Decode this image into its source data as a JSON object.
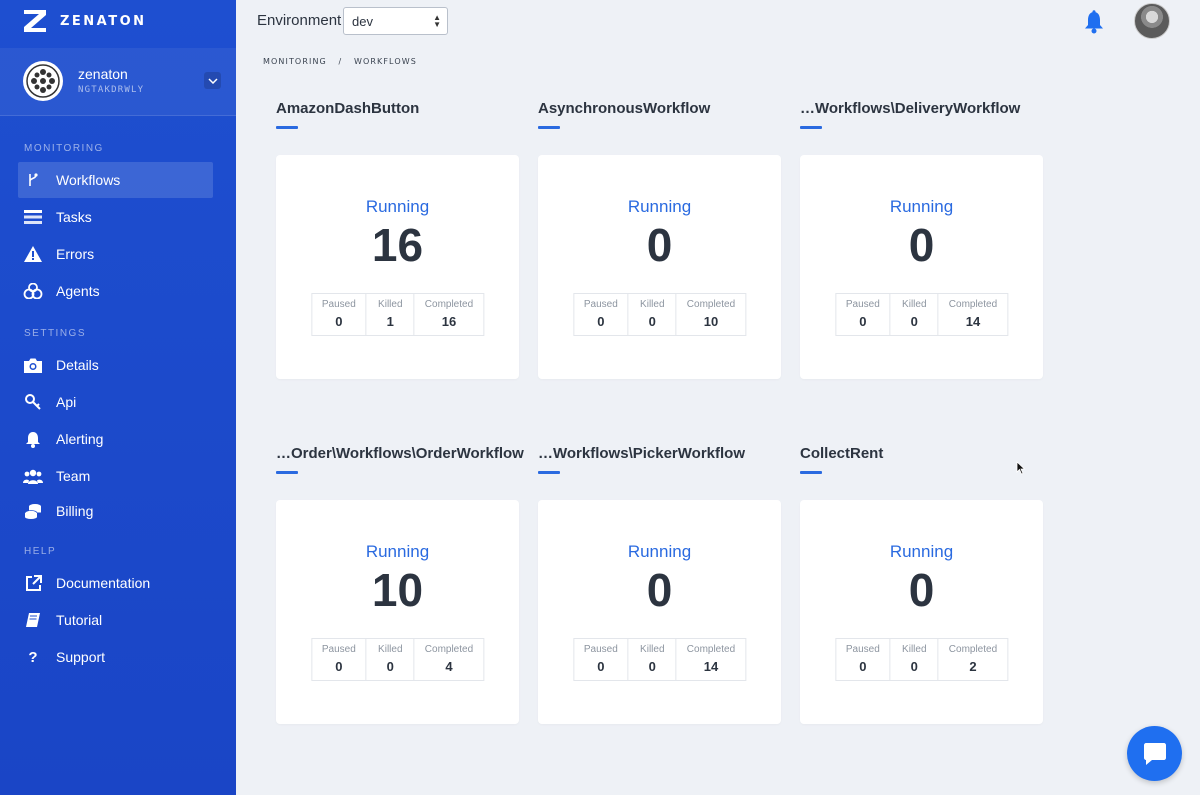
{
  "brand": {
    "name": "ZENATON"
  },
  "account": {
    "name": "zenaton",
    "id": "NGTAKDRWLY"
  },
  "sidebar": {
    "sections": [
      {
        "title": "MONITORING",
        "items": [
          {
            "label": "Workflows",
            "icon": "branch-icon",
            "active": true
          },
          {
            "label": "Tasks",
            "icon": "list-icon"
          },
          {
            "label": "Errors",
            "icon": "warning-icon"
          },
          {
            "label": "Agents",
            "icon": "agents-icon"
          }
        ]
      },
      {
        "title": "SETTINGS",
        "items": [
          {
            "label": "Details",
            "icon": "camera-icon"
          },
          {
            "label": "Api",
            "icon": "key-icon"
          },
          {
            "label": "Alerting",
            "icon": "bell-icon"
          },
          {
            "label": "Team",
            "icon": "team-icon"
          },
          {
            "label": "Billing",
            "icon": "coins-icon"
          }
        ]
      },
      {
        "title": "HELP",
        "items": [
          {
            "label": "Documentation",
            "icon": "external-link-icon"
          },
          {
            "label": "Tutorial",
            "icon": "book-icon"
          },
          {
            "label": "Support",
            "icon": "question-icon"
          }
        ]
      }
    ]
  },
  "topbar": {
    "env_label": "Environment",
    "env_value": "dev"
  },
  "breadcrumb": [
    "MONITORING",
    "/",
    "WORKFLOWS"
  ],
  "labels": {
    "running": "Running",
    "paused": "Paused",
    "killed": "Killed",
    "completed": "Completed"
  },
  "workflows": [
    {
      "name": "AmazonDashButton",
      "running": "16",
      "paused": "0",
      "killed": "1",
      "completed": "16"
    },
    {
      "name": "AsynchronousWorkflow",
      "running": "0",
      "paused": "0",
      "killed": "0",
      "completed": "10"
    },
    {
      "name": "…Workflows\\DeliveryWorkflow",
      "running": "0",
      "paused": "0",
      "killed": "0",
      "completed": "14"
    },
    {
      "name": "…Order\\Workflows\\OrderWorkflow",
      "running": "10",
      "paused": "0",
      "killed": "0",
      "completed": "4"
    },
    {
      "name": "…Workflows\\PickerWorkflow",
      "running": "0",
      "paused": "0",
      "killed": "0",
      "completed": "14"
    },
    {
      "name": "CollectRent",
      "running": "0",
      "paused": "0",
      "killed": "0",
      "completed": "2"
    }
  ],
  "colors": {
    "sidebar": "#1e4fd0",
    "accent": "#2a6ae0",
    "background": "#eef1f6"
  }
}
